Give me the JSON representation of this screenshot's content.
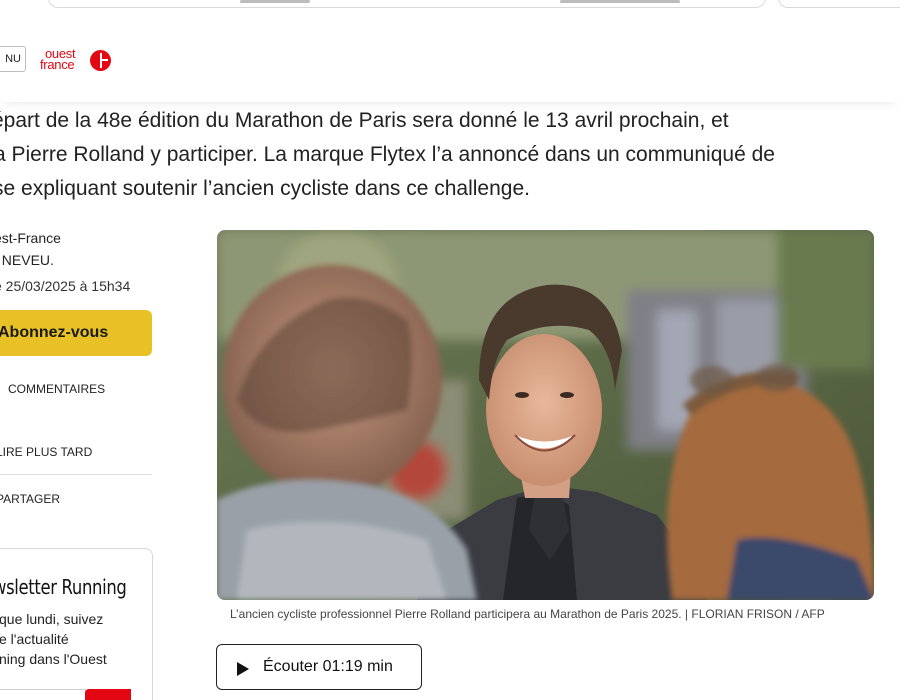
{
  "header": {
    "menu_label": "NU",
    "logo_line1": "ouest",
    "logo_line2": "france"
  },
  "intro": {
    "line1": "épart de la 48e édition du Marathon de Paris sera donné le 13 avril prochain, et",
    "line2": "a Pierre Rolland y participer. La marque Flytex l’a annoncé dans un communiqué de",
    "line3": "se expliquant soutenir l’ancien cycliste dans ce challenge."
  },
  "meta": {
    "source": "est-France",
    "author": ". NEVEU.",
    "date": "e 25/03/2025 à 15h34",
    "subscribe_label": "Abonnez-vous",
    "comments_label": "COMMENTAIRES",
    "read_later_label": "LIRE PLUS TARD",
    "share_label": "PARTAGER"
  },
  "newsletter": {
    "title": "wsletter Running",
    "text_lines": [
      "que lundi, suivez",
      "e l'actualité",
      "ning dans l'Ouest"
    ]
  },
  "photo": {
    "caption": "L’ancien cycliste professionnel Pierre Rolland participera au Marathon de Paris 2025. | FLORIAN FRISON / AFP"
  },
  "audio": {
    "listen_label": "Écouter 01:19 min",
    "icon": "play-icon"
  },
  "colors": {
    "brand_red": "#e30613",
    "subscribe_yellow": "#e8c127"
  }
}
